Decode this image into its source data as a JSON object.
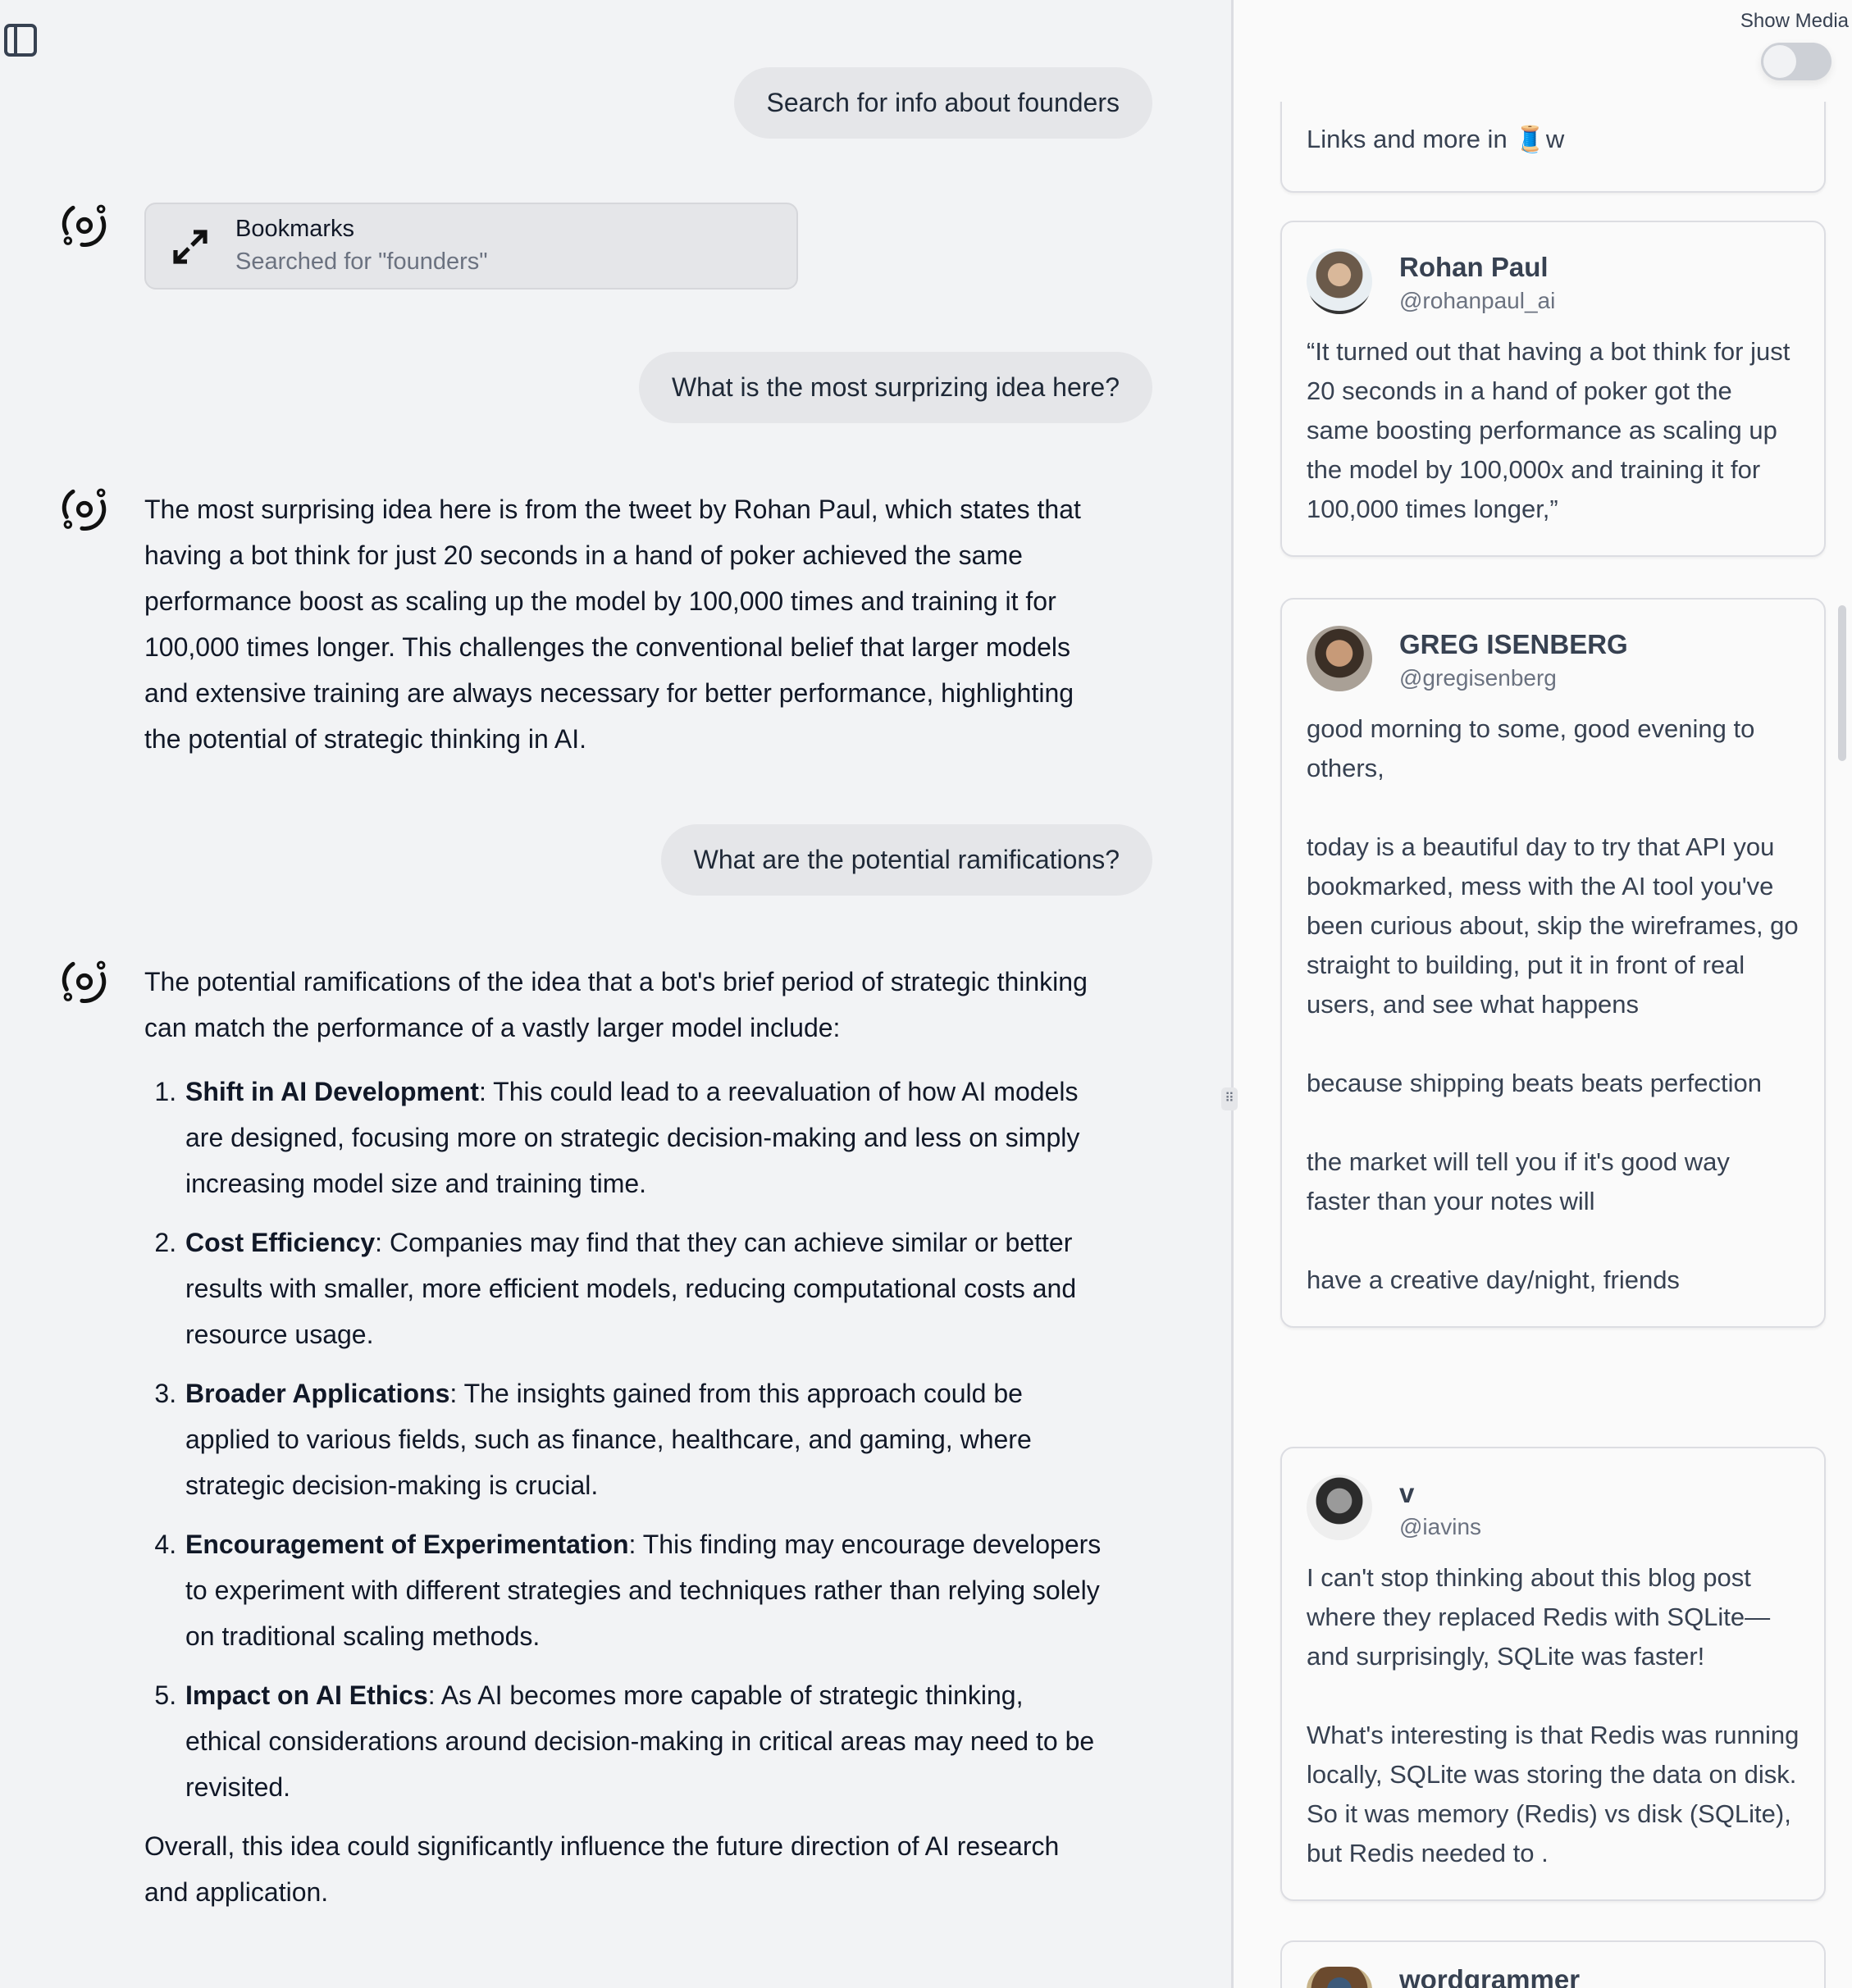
{
  "chat": {
    "messages": [
      {
        "role": "user",
        "text": "Search for info about founders"
      },
      {
        "role": "tool",
        "title": "Bookmarks",
        "subtitle": "Searched for \"founders\""
      },
      {
        "role": "user",
        "text": "What is the most surprizing idea here?"
      },
      {
        "role": "assistant",
        "text": "The most surprising idea here is from the tweet by Rohan Paul, which states that having a bot think for just 20 seconds in a hand of poker achieved the same performance boost as scaling up the model by 100,000 times and training it for 100,000 times longer. This challenges the conventional belief that larger models and extensive training are always necessary for better performance, highlighting the potential of strategic thinking in AI."
      },
      {
        "role": "user",
        "text": "What are the potential ramifications?"
      },
      {
        "role": "assistant",
        "intro": "The potential ramifications of the idea that a bot's brief period of strategic thinking can match the performance of a vastly larger model include:",
        "items": [
          {
            "title": "Shift in AI Development",
            "text": ": This could lead to a reevaluation of how AI models are designed, focusing more on strategic decision-making and less on simply increasing model size and training time."
          },
          {
            "title": "Cost Efficiency",
            "text": ": Companies may find that they can achieve similar or better results with smaller, more efficient models, reducing computational costs and resource usage."
          },
          {
            "title": "Broader Applications",
            "text": ": The insights gained from this approach could be applied to various fields, such as finance, healthcare, and gaming, where strategic decision-making is crucial."
          },
          {
            "title": "Encouragement of Experimentation",
            "text": ": This finding may encourage developers to experiment with different strategies and techniques rather than relying solely on traditional scaling methods."
          },
          {
            "title": "Impact on AI Ethics",
            "text": ": As AI becomes more capable of strategic thinking, ethical considerations around decision-making in critical areas may need to be revisited."
          }
        ],
        "outro": "Overall, this idea could significantly influence the future direction of AI research and application."
      }
    ]
  },
  "panel": {
    "show_media_label": "Show Media",
    "show_media_on": false,
    "tweets": [
      {
        "text": "Links and more in 🧵w"
      },
      {
        "name": "Rohan Paul",
        "handle": "@rohanpaul_ai",
        "text": "“It turned out that having a bot think for just 20 seconds in a hand of poker got the same boosting performance as scaling up the model by 100,000x and training it for 100,000 times longer,”"
      },
      {
        "name": "GREG ISENBERG",
        "handle": "@gregisenberg",
        "text": "good morning to some, good evening to others,\n\ntoday is a beautiful day to try that API you bookmarked, mess with the AI tool you've been curious about, skip the wireframes, go straight to building, put it in front of real users, and see what happens\n\nbecause shipping beats beats perfection\n\nthe market will tell you if it's good way faster than your notes will\n\nhave a creative day/night, friends"
      },
      {
        "name": "v",
        "handle": "@iavins",
        "text": "I can't stop thinking about this blog post where they replaced Redis with SQLite—and surprisingly, SQLite was faster!\n\nWhat's interesting is that Redis was running locally, SQLite was storing the data on disk. So it was memory (Redis) vs disk (SQLite), but Redis needed to ."
      },
      {
        "name": "wordgrammer"
      }
    ]
  },
  "icons": {
    "sidebar": "sidebar-toggle-icon",
    "assistant": "assistant-logo-icon",
    "tool": "expand-arrows-icon"
  }
}
